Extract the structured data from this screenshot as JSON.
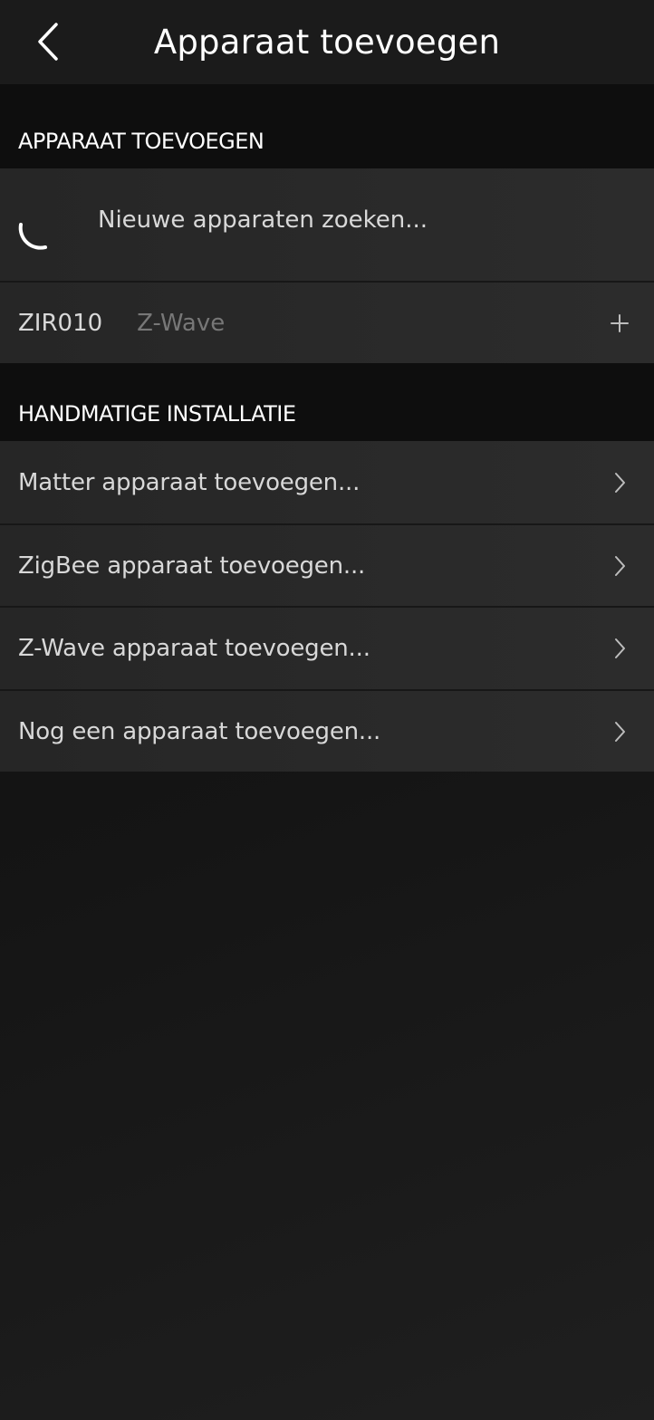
{
  "header": {
    "title": "Apparaat toevoegen",
    "back_icon": "chevron-left-icon"
  },
  "add_section": {
    "title": "APPARAAT TOEVOEGEN",
    "search_status": "Nieuwe apparaten zoeken...",
    "found_devices": [
      {
        "name": "ZIR010",
        "protocol": "Z-Wave",
        "action_icon": "plus-icon"
      }
    ]
  },
  "manual_section": {
    "title": "HANDMATIGE INSTALLATIE",
    "items": [
      {
        "label": "Matter apparaat toevoegen..."
      },
      {
        "label": "ZigBee apparaat toevoegen..."
      },
      {
        "label": "Z-Wave apparaat toevoegen..."
      },
      {
        "label": "Nog een apparaat toevoegen..."
      }
    ]
  },
  "colors": {
    "background": "#111111",
    "header_bg": "#1b1b1b",
    "section_bg": "#0e0e0e",
    "row_bg": "#2a2a2a",
    "text_primary": "#ffffff",
    "text_secondary": "#d8d8d8",
    "text_muted": "#777777"
  }
}
